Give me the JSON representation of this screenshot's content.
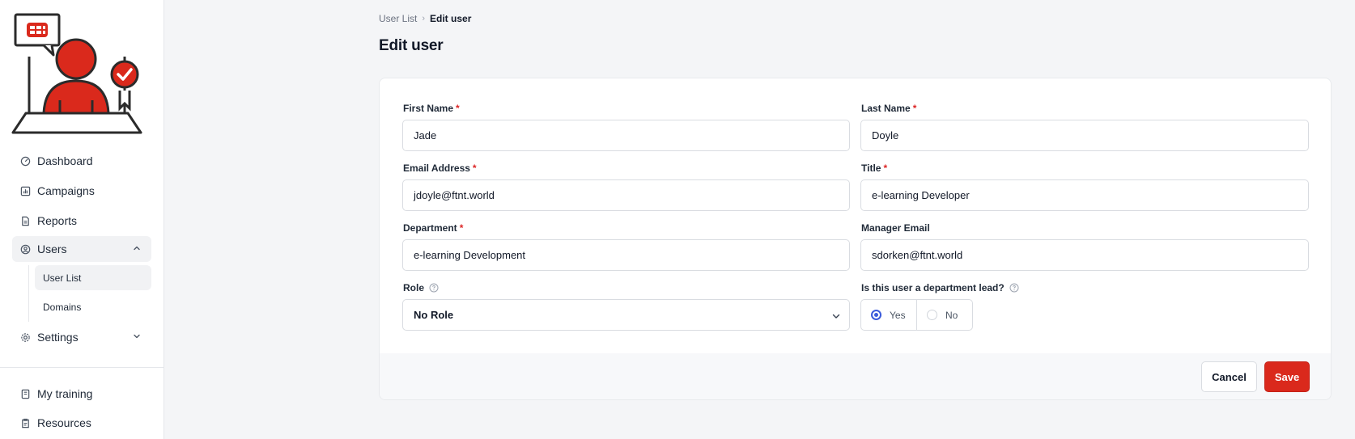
{
  "sidebar": {
    "items": [
      {
        "label": "Dashboard",
        "icon": "gauge-icon"
      },
      {
        "label": "Campaigns",
        "icon": "chart-icon"
      },
      {
        "label": "Reports",
        "icon": "document-icon"
      },
      {
        "label": "Users",
        "icon": "user-circle-icon",
        "expanded": true
      },
      {
        "label": "Settings",
        "icon": "gear-icon"
      },
      {
        "label": "My training",
        "icon": "book-icon"
      },
      {
        "label": "Resources",
        "icon": "clipboard-icon"
      }
    ],
    "sub_items": [
      {
        "label": "User List",
        "active": true
      },
      {
        "label": "Domains"
      }
    ]
  },
  "breadcrumb": {
    "parent": "User List",
    "current": "Edit user"
  },
  "page_title": "Edit user",
  "form": {
    "first_name": {
      "label": "First Name",
      "required": "*",
      "value": "Jade"
    },
    "last_name": {
      "label": "Last Name",
      "required": "*",
      "value": "Doyle"
    },
    "email": {
      "label": "Email Address",
      "required": "*",
      "value": "jdoyle@ftnt.world"
    },
    "title": {
      "label": "Title",
      "required": "*",
      "value": "e-learning Developer"
    },
    "department": {
      "label": "Department",
      "required": "*",
      "value": "e-learning Development"
    },
    "manager_email": {
      "label": "Manager Email",
      "value": "sdorken@ftnt.world"
    },
    "role": {
      "label": "Role",
      "value": "No Role"
    },
    "dept_lead": {
      "label": "Is this user a department lead?",
      "options": [
        "Yes",
        "No"
      ],
      "selected": "Yes"
    }
  },
  "actions": {
    "cancel": "Cancel",
    "save": "Save"
  },
  "colors": {
    "brand": "#da291c",
    "radio_selected": "#3b5bdb",
    "required": "#dc2626"
  }
}
